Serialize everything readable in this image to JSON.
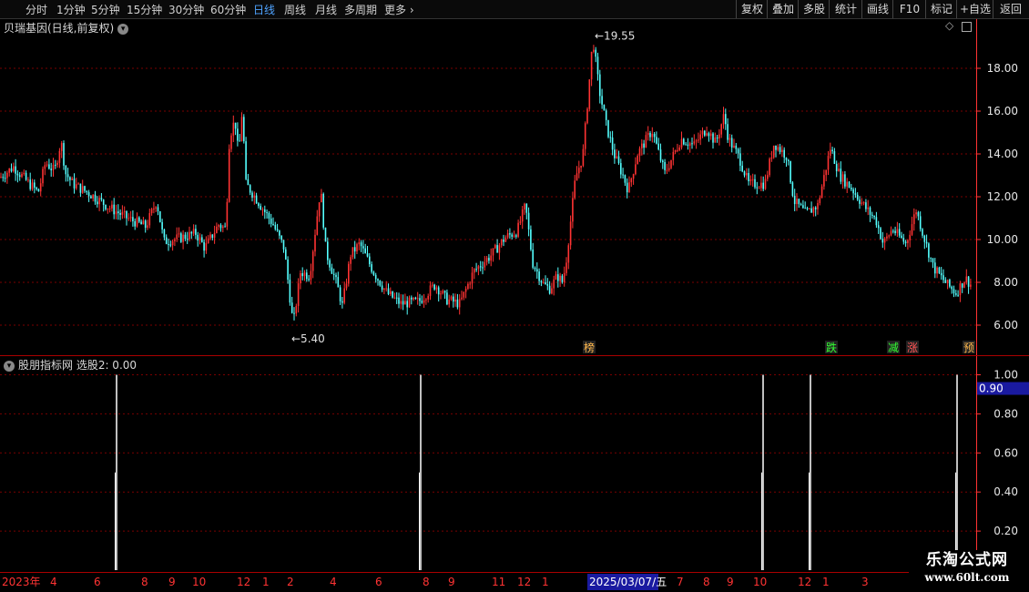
{
  "toolbar": {
    "periods": [
      "分时",
      "1分钟",
      "5分钟",
      "15分钟",
      "30分钟",
      "60分钟",
      "日线",
      "周线",
      "月线",
      "多周期",
      "更多"
    ],
    "active_period": "日线",
    "right_buttons": [
      "复权",
      "叠加",
      "多股",
      "统计",
      "画线",
      "F10",
      "标记",
      "+自选",
      "返回"
    ]
  },
  "main_chart": {
    "stock_title": "贝瑞基因(日线,前复权)",
    "high_label": "19.55",
    "low_label": "5.40",
    "diamond_icon": "◇"
  },
  "indicator": {
    "title": "股朋指标网 选股2: 0.00",
    "cursor_value": "0.90"
  },
  "date_axis": {
    "labels": [
      "2023年",
      "4",
      "6",
      "8",
      "9",
      "10",
      "12",
      "1",
      "2",
      "4",
      "6",
      "8",
      "9",
      "11",
      "12",
      "1",
      "7",
      "8",
      "9",
      "10",
      "12",
      "1",
      "3"
    ],
    "highlight": "2025/03/07/五"
  },
  "watermark": {
    "line1": "乐淘公式网",
    "line2": "www.60lt.com"
  },
  "colors": {
    "up": "#ff3333",
    "down": "#54ffff",
    "grid": "#7a0000",
    "axis": "#ff3333",
    "signal": "#ffffff"
  },
  "chart_data": [
    {
      "type": "candlestick",
      "title": "贝瑞基因(日线,前复权)",
      "y_ticks": [
        6.0,
        8.0,
        10.0,
        12.0,
        14.0,
        16.0,
        18.0
      ],
      "ylim": [
        5.0,
        20.2
      ],
      "x_range": [
        0,
        1070
      ],
      "close_series": [
        [
          0,
          12.9
        ],
        [
          15,
          13.4
        ],
        [
          30,
          12.7
        ],
        [
          42,
          12.2
        ],
        [
          50,
          13.6
        ],
        [
          60,
          13.2
        ],
        [
          67,
          14.6
        ],
        [
          72,
          13.1
        ],
        [
          80,
          12.6
        ],
        [
          100,
          12.1
        ],
        [
          120,
          11.5
        ],
        [
          140,
          11.0
        ],
        [
          160,
          10.6
        ],
        [
          172,
          11.8
        ],
        [
          180,
          9.9
        ],
        [
          200,
          10.1
        ],
        [
          215,
          10.3
        ],
        [
          225,
          9.6
        ],
        [
          240,
          10.7
        ],
        [
          248,
          10.5
        ],
        [
          252,
          14.8
        ],
        [
          258,
          15.6
        ],
        [
          262,
          13.9
        ],
        [
          266,
          16.1
        ],
        [
          270,
          12.6
        ],
        [
          280,
          12.0
        ],
        [
          300,
          10.7
        ],
        [
          312,
          9.6
        ],
        [
          322,
          6.0
        ],
        [
          330,
          8.5
        ],
        [
          340,
          8.3
        ],
        [
          352,
          12.4
        ],
        [
          358,
          9.4
        ],
        [
          370,
          7.9
        ],
        [
          376,
          6.9
        ],
        [
          385,
          9.3
        ],
        [
          395,
          9.8
        ],
        [
          410,
          8.5
        ],
        [
          425,
          7.5
        ],
        [
          440,
          7.0
        ],
        [
          460,
          7.1
        ],
        [
          478,
          7.9
        ],
        [
          490,
          7.2
        ],
        [
          505,
          7.0
        ],
        [
          520,
          8.5
        ],
        [
          540,
          9.3
        ],
        [
          555,
          10.1
        ],
        [
          568,
          10.4
        ],
        [
          577,
          11.6
        ],
        [
          585,
          8.9
        ],
        [
          597,
          7.9
        ],
        [
          604,
          7.7
        ],
        [
          612,
          8.3
        ],
        [
          618,
          8.0
        ],
        [
          622,
          9.1
        ],
        [
          632,
          12.9
        ],
        [
          640,
          13.9
        ],
        [
          646,
          16.8
        ],
        [
          651,
          19.4
        ],
        [
          658,
          17.0
        ],
        [
          666,
          15.3
        ],
        [
          675,
          13.9
        ],
        [
          684,
          13.0
        ],
        [
          690,
          12.3
        ],
        [
          700,
          14.0
        ],
        [
          716,
          15.1
        ],
        [
          730,
          13.1
        ],
        [
          748,
          14.7
        ],
        [
          762,
          14.4
        ],
        [
          776,
          15.2
        ],
        [
          786,
          14.5
        ],
        [
          795,
          15.8
        ],
        [
          800,
          14.7
        ],
        [
          812,
          13.8
        ],
        [
          822,
          12.6
        ],
        [
          840,
          12.6
        ],
        [
          850,
          14.5
        ],
        [
          864,
          13.9
        ],
        [
          872,
          11.8
        ],
        [
          885,
          11.2
        ],
        [
          898,
          11.6
        ],
        [
          912,
          14.3
        ],
        [
          922,
          13.0
        ],
        [
          935,
          12.4
        ],
        [
          950,
          11.5
        ],
        [
          962,
          10.9
        ],
        [
          970,
          9.8
        ],
        [
          980,
          10.5
        ],
        [
          995,
          9.8
        ],
        [
          1006,
          11.4
        ],
        [
          1014,
          10.2
        ],
        [
          1025,
          8.7
        ],
        [
          1040,
          7.9
        ],
        [
          1050,
          7.5
        ],
        [
          1060,
          8.2
        ],
        [
          1068,
          7.8
        ]
      ],
      "annotations": [
        {
          "text": "19.55",
          "kind": "high",
          "x": 651,
          "y": 19.55
        },
        {
          "text": "5.40",
          "kind": "low",
          "x": 322,
          "y": 5.4
        },
        {
          "text": "榜",
          "x": 647,
          "color": "#ffb84d"
        },
        {
          "text": "跌",
          "x": 913,
          "color": "#33ff33"
        },
        {
          "text": "减",
          "x": 981,
          "color": "#33ff33"
        },
        {
          "text": "涨",
          "x": 1002,
          "color": "#ff5555"
        },
        {
          "text": "预",
          "x": 1064,
          "color": "#ffb84d"
        }
      ]
    },
    {
      "type": "bar",
      "title": "股朋指标网 选股2: 0.00",
      "y_ticks": [
        0.2,
        0.4,
        0.6,
        0.8,
        1.0
      ],
      "ylim": [
        0,
        1.05
      ],
      "signals_x": [
        128,
        462,
        838,
        890,
        1051
      ],
      "signal_value": 1.0
    }
  ]
}
